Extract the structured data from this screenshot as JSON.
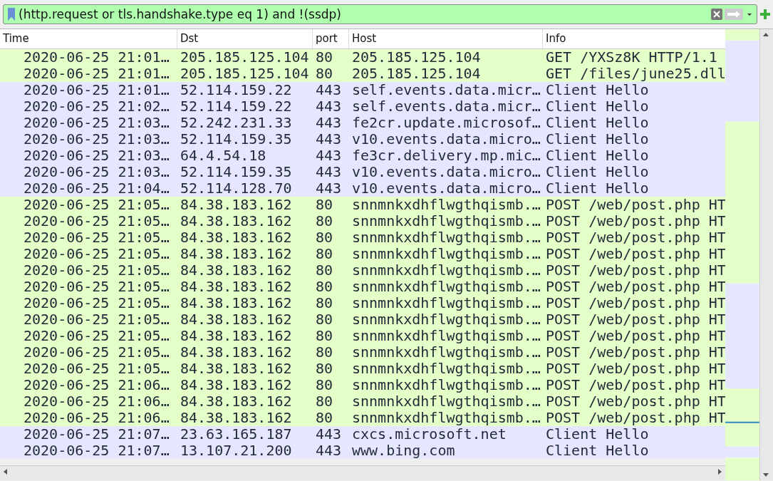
{
  "filter": {
    "value": "(http.request or tls.handshake.type eq 1) and !(ssdp)"
  },
  "table": {
    "columns": [
      "Time",
      "Dst",
      "port",
      "Host",
      "Info"
    ],
    "rows": [
      {
        "kind": "http",
        "cells": [
          "2020-06-25 21:01…",
          "205.185.125.104",
          "80",
          "205.185.125.104",
          "GET /YXSz8K HTTP/1.1"
        ]
      },
      {
        "kind": "http",
        "cells": [
          "2020-06-25 21:01…",
          "205.185.125.104",
          "80",
          "205.185.125.104",
          "GET /files/june25.dll"
        ]
      },
      {
        "kind": "tls",
        "cells": [
          "2020-06-25 21:01…",
          "52.114.159.22",
          "443",
          "self.events.data.micr…",
          "Client Hello"
        ]
      },
      {
        "kind": "tls",
        "cells": [
          "2020-06-25 21:02…",
          "52.114.159.22",
          "443",
          "self.events.data.micr…",
          "Client Hello"
        ]
      },
      {
        "kind": "tls",
        "cells": [
          "2020-06-25 21:03…",
          "52.242.231.33",
          "443",
          "fe2cr.update.microsof…",
          "Client Hello"
        ]
      },
      {
        "kind": "tls",
        "cells": [
          "2020-06-25 21:03…",
          "52.114.159.35",
          "443",
          "v10.events.data.micro…",
          "Client Hello"
        ]
      },
      {
        "kind": "tls",
        "cells": [
          "2020-06-25 21:03…",
          "64.4.54.18",
          "443",
          "fe3cr.delivery.mp.mic…",
          "Client Hello"
        ]
      },
      {
        "kind": "tls",
        "cells": [
          "2020-06-25 21:03…",
          "52.114.159.35",
          "443",
          "v10.events.data.micro…",
          "Client Hello"
        ]
      },
      {
        "kind": "tls",
        "cells": [
          "2020-06-25 21:04…",
          "52.114.128.70",
          "443",
          "v10.events.data.micro…",
          "Client Hello"
        ]
      },
      {
        "kind": "http",
        "cells": [
          "2020-06-25 21:05…",
          "84.38.183.162",
          "80",
          "snnmnkxdhflwgthqismb.…",
          "POST /web/post.php HT"
        ]
      },
      {
        "kind": "http",
        "cells": [
          "2020-06-25 21:05…",
          "84.38.183.162",
          "80",
          "snnmnkxdhflwgthqismb.…",
          "POST /web/post.php HT"
        ]
      },
      {
        "kind": "http",
        "cells": [
          "2020-06-25 21:05…",
          "84.38.183.162",
          "80",
          "snnmnkxdhflwgthqismb.…",
          "POST /web/post.php HT"
        ]
      },
      {
        "kind": "http",
        "cells": [
          "2020-06-25 21:05…",
          "84.38.183.162",
          "80",
          "snnmnkxdhflwgthqismb.…",
          "POST /web/post.php HT"
        ]
      },
      {
        "kind": "http",
        "cells": [
          "2020-06-25 21:05…",
          "84.38.183.162",
          "80",
          "snnmnkxdhflwgthqismb.…",
          "POST /web/post.php HT"
        ]
      },
      {
        "kind": "http",
        "cells": [
          "2020-06-25 21:05…",
          "84.38.183.162",
          "80",
          "snnmnkxdhflwgthqismb.…",
          "POST /web/post.php HT"
        ]
      },
      {
        "kind": "http",
        "cells": [
          "2020-06-25 21:05…",
          "84.38.183.162",
          "80",
          "snnmnkxdhflwgthqismb.…",
          "POST /web/post.php HT"
        ]
      },
      {
        "kind": "http",
        "cells": [
          "2020-06-25 21:05…",
          "84.38.183.162",
          "80",
          "snnmnkxdhflwgthqismb.…",
          "POST /web/post.php HT"
        ]
      },
      {
        "kind": "http",
        "cells": [
          "2020-06-25 21:05…",
          "84.38.183.162",
          "80",
          "snnmnkxdhflwgthqismb.…",
          "POST /web/post.php HT"
        ]
      },
      {
        "kind": "http",
        "cells": [
          "2020-06-25 21:05…",
          "84.38.183.162",
          "80",
          "snnmnkxdhflwgthqismb.…",
          "POST /web/post.php HT"
        ]
      },
      {
        "kind": "http",
        "cells": [
          "2020-06-25 21:05…",
          "84.38.183.162",
          "80",
          "snnmnkxdhflwgthqismb.…",
          "POST /web/post.php HT"
        ]
      },
      {
        "kind": "http",
        "cells": [
          "2020-06-25 21:06…",
          "84.38.183.162",
          "80",
          "snnmnkxdhflwgthqismb.…",
          "POST /web/post.php HT"
        ]
      },
      {
        "kind": "http",
        "cells": [
          "2020-06-25 21:06…",
          "84.38.183.162",
          "80",
          "snnmnkxdhflwgthqismb.…",
          "POST /web/post.php HT"
        ]
      },
      {
        "kind": "http",
        "cells": [
          "2020-06-25 21:06…",
          "84.38.183.162",
          "80",
          "snnmnkxdhflwgthqismb.…",
          "POST /web/post.php HT"
        ]
      },
      {
        "kind": "tls",
        "cells": [
          "2020-06-25 21:07…",
          "23.63.165.187",
          "443",
          "cxcs.microsoft.net",
          "Client Hello"
        ]
      },
      {
        "kind": "tls",
        "cells": [
          "2020-06-25 21:07…",
          "13.107.21.200",
          "443",
          "www.bing.com",
          "Client Hello"
        ]
      }
    ]
  }
}
